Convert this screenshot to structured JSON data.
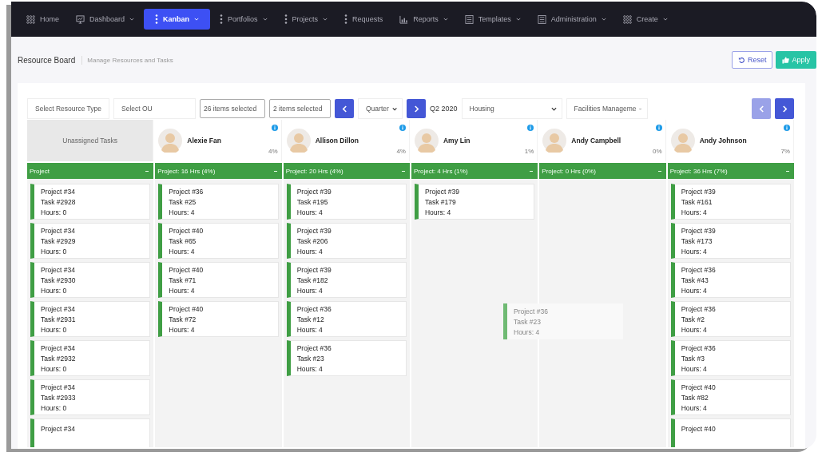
{
  "nav": [
    {
      "label": "Home",
      "kind": "grid",
      "menu": false,
      "selected": false
    },
    {
      "label": "Dashboard",
      "kind": "board",
      "menu": true,
      "selected": false
    },
    {
      "label": "Kanban",
      "kind": "dots",
      "menu": true,
      "selected": true
    },
    {
      "label": "Portfolios",
      "kind": "dots",
      "menu": true,
      "selected": false
    },
    {
      "label": "Projects",
      "kind": "dots",
      "menu": true,
      "selected": false
    },
    {
      "label": "Requests",
      "kind": "dots",
      "menu": false,
      "selected": false
    },
    {
      "label": "Reports",
      "kind": "bars",
      "menu": true,
      "selected": false
    },
    {
      "label": "Templates",
      "kind": "form",
      "menu": true,
      "selected": false
    },
    {
      "label": "Administration",
      "kind": "form",
      "menu": true,
      "selected": false
    },
    {
      "label": "Create",
      "kind": "grid",
      "menu": true,
      "selected": false
    }
  ],
  "header": {
    "title": "Resource Board",
    "subtitle": "Manage Resources and Tasks",
    "reset": "Reset",
    "apply": "Apply"
  },
  "filters": {
    "resource_type": "Select Resource Type",
    "ou": {
      "placeholder": "Select OU"
    },
    "multi_1": "26 items selected",
    "multi_2": "2 items selected",
    "period": "Quarter",
    "period_label": "Q2 2020",
    "department": "Housing",
    "group": "Facilities Manageme",
    "prev_disabled": true
  },
  "columns": [
    {
      "kind": "unassigned",
      "name": "Unassigned Tasks",
      "bar": "Project",
      "cards": [
        {
          "project": "Project #34",
          "task": "Task #2928",
          "hours": "Hours: 0"
        },
        {
          "project": "Project #34",
          "task": "Task #2929",
          "hours": "Hours: 0"
        },
        {
          "project": "Project #34",
          "task": "Task #2930",
          "hours": "Hours: 0"
        },
        {
          "project": "Project #34",
          "task": "Task #2931",
          "hours": "Hours: 0"
        },
        {
          "project": "Project #34",
          "task": "Task #2932",
          "hours": "Hours: 0"
        },
        {
          "project": "Project #34",
          "task": "Task #2933",
          "hours": "Hours: 0"
        },
        {
          "project": "Project #34"
        }
      ]
    },
    {
      "kind": "person",
      "name": "Alexie Fan",
      "percent": "4%",
      "bar": "Project: 16 Hrs (4%)",
      "cards": [
        {
          "project": "Project #36",
          "task": "Task #25",
          "hours": "Hours: 4"
        },
        {
          "project": "Project #40",
          "task": "Task #65",
          "hours": "Hours: 4"
        },
        {
          "project": "Project #40",
          "task": "Task #71",
          "hours": "Hours: 4"
        },
        {
          "project": "Project #40",
          "task": "Task #72",
          "hours": "Hours: 4"
        }
      ]
    },
    {
      "kind": "person",
      "name": "Allison Dillon",
      "percent": "4%",
      "bar": "Project: 20 Hrs (4%)",
      "cards": [
        {
          "project": "Project #39",
          "task": "Task #195",
          "hours": "Hours: 4"
        },
        {
          "project": "Project #39",
          "task": "Task #206",
          "hours": "Hours: 4"
        },
        {
          "project": "Project #39",
          "task": "Task #182",
          "hours": "Hours: 4"
        },
        {
          "project": "Project #36",
          "task": "Task #12",
          "hours": "Hours: 4"
        },
        {
          "project": "Project #36",
          "task": "Task #23",
          "hours": "Hours: 4"
        }
      ]
    },
    {
      "kind": "person",
      "name": "Amy Lin",
      "percent": "1%",
      "bar": "Project: 4 Hrs (1%)",
      "cards": [
        {
          "project": "Project #39",
          "task": "Task #179",
          "hours": "Hours: 4"
        }
      ]
    },
    {
      "kind": "person",
      "name": "Andy Campbell",
      "percent": "0%",
      "bar": "Project: 0 Hrs (0%)"
    },
    {
      "kind": "person",
      "name": "Andy Johnson",
      "percent": "7%",
      "bar": "Project: 36 Hrs (7%)",
      "cards": [
        {
          "project": "Project #39",
          "task": "Task #161",
          "hours": "Hours: 4"
        },
        {
          "project": "Project #39",
          "task": "Task #173",
          "hours": "Hours: 4"
        },
        {
          "project": "Project #36",
          "task": "Task #43",
          "hours": "Hours: 4"
        },
        {
          "project": "Project #36",
          "task": "Task #2",
          "hours": "Hours: 4"
        },
        {
          "project": "Project #36",
          "task": "Task #3",
          "hours": "Hours: 4"
        },
        {
          "project": "Project #40",
          "task": "Task #82",
          "hours": "Hours: 4"
        },
        {
          "project": "Project #40"
        }
      ]
    }
  ],
  "dragging": {
    "project": "Project #36",
    "task": "Task #23",
    "hours": "Hours: 4"
  }
}
